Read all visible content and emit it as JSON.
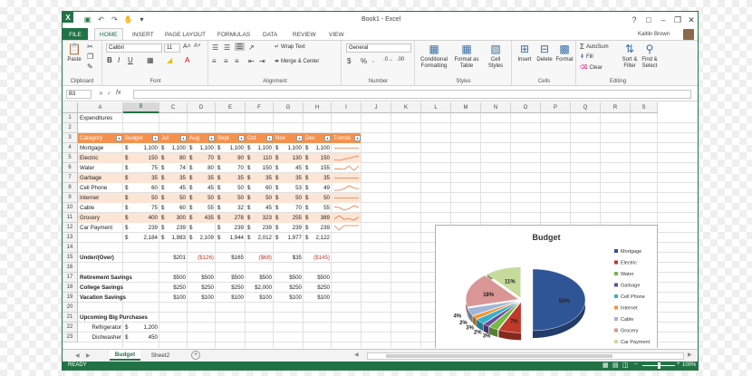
{
  "window": {
    "title": "Book1 - Excel",
    "help": "?",
    "user": "Kaitlin Brown"
  },
  "tabs": [
    "FILE",
    "HOME",
    "INSERT",
    "PAGE LAYOUT",
    "FORMULAS",
    "DATA",
    "REVIEW",
    "VIEW"
  ],
  "ribbon": {
    "clipboard": {
      "paste": "Paste",
      "label": "Clipboard"
    },
    "font": {
      "name": "Calibri",
      "size": "11",
      "label": "Font"
    },
    "alignment": {
      "wrap": "Wrap Text",
      "merge": "Merge & Center",
      "label": "Alignment"
    },
    "number": {
      "format": "General",
      "label": "Number"
    },
    "styles": {
      "conditional": "Conditional Formatting",
      "table": "Format as Table",
      "cell": "Cell Styles",
      "label": "Styles"
    },
    "cells": {
      "insert": "Insert",
      "delete": "Delete",
      "format": "Format",
      "label": "Cells"
    },
    "editing": {
      "autosum": "AutoSum",
      "fill": "Fill",
      "clear": "Clear",
      "sort": "Sort & Filter",
      "find": "Find & Select",
      "label": "Editing"
    }
  },
  "formula_bar": {
    "name_box": "B3",
    "fx": "fx",
    "value": ""
  },
  "columns": [
    "A",
    "B",
    "C",
    "D",
    "E",
    "F",
    "G",
    "H",
    "I",
    "J",
    "K",
    "L",
    "M",
    "N",
    "O",
    "P",
    "Q",
    "R",
    "S"
  ],
  "selected_column": "B",
  "rows": [
    "1",
    "2",
    "3",
    "4",
    "5",
    "6",
    "7",
    "8",
    "9",
    "10",
    "11",
    "12",
    "13",
    "14",
    "15",
    "16",
    "17",
    "18",
    "19",
    "20",
    "21",
    "22",
    "23"
  ],
  "sheet": {
    "r1": "Expenditures",
    "headers": [
      "Category",
      "Budget",
      "Jul",
      "Aug",
      "Sept",
      "Oct",
      "Nov",
      "Dec",
      "Trends"
    ],
    "items": [
      {
        "cat": "Mortgage",
        "v": [
          "1,100",
          "1,100",
          "1,100",
          "1,100",
          "1,100",
          "1,100",
          "1,100"
        ]
      },
      {
        "cat": "Electric",
        "v": [
          "150",
          "80",
          "70",
          "90",
          "110",
          "130",
          "150"
        ]
      },
      {
        "cat": "Water",
        "v": [
          "75",
          "74",
          "80",
          "70",
          "150",
          "45",
          "155"
        ]
      },
      {
        "cat": "Garbage",
        "v": [
          "35",
          "35",
          "35",
          "35",
          "35",
          "35",
          "35"
        ]
      },
      {
        "cat": "Cell Phone",
        "v": [
          "60",
          "45",
          "45",
          "50",
          "60",
          "53",
          "49"
        ]
      },
      {
        "cat": "Internet",
        "v": [
          "50",
          "50",
          "50",
          "50",
          "50",
          "50",
          "50"
        ]
      },
      {
        "cat": "Cable",
        "v": [
          "75",
          "60",
          "55",
          "32",
          "45",
          "70",
          "55"
        ]
      },
      {
        "cat": "Grocery",
        "v": [
          "400",
          "300",
          "435",
          "278",
          "323",
          "255",
          "389"
        ]
      },
      {
        "cat": "Car Payment",
        "v": [
          "239",
          "239",
          "",
          "239",
          "239",
          "239",
          "239"
        ]
      }
    ],
    "totals": [
      "2,184",
      "1,983",
      "2,109",
      "1,944",
      "2,012",
      "1,977",
      "2,122"
    ],
    "under_over": {
      "label": "Under/(Over)",
      "v": [
        "$201",
        "($126)",
        "$165",
        "($68)",
        "$35",
        "($145)"
      ]
    },
    "savings": [
      {
        "label": "Retirement Savings",
        "v": [
          "$500",
          "$500",
          "$500",
          "$500",
          "$500",
          "$500"
        ]
      },
      {
        "label": "College Savings",
        "v": [
          "$250",
          "$250",
          "$250",
          "$2,000",
          "$250",
          "$250"
        ]
      },
      {
        "label": "Vacation Savings",
        "v": [
          "$100",
          "$100",
          "$100",
          "$100",
          "$100",
          "$100"
        ]
      }
    ],
    "upcoming": {
      "label": "Upcoming Big Purchases",
      "items": [
        {
          "name": "Refrigerator",
          "value": "1,200"
        },
        {
          "name": "Dishwasher",
          "value": "450"
        }
      ]
    },
    "currency": "$"
  },
  "chart_data": {
    "type": "pie",
    "title": "Budget",
    "categories": [
      "Mortgage",
      "Electric",
      "Water",
      "Garbage",
      "Cell Phone",
      "Internet",
      "Cable",
      "Grocery",
      "Car Payment"
    ],
    "values": [
      50,
      7,
      3,
      2,
      3,
      2,
      4,
      18,
      11
    ],
    "labels": [
      "50%",
      "7%",
      "3%",
      "2%",
      "3%",
      "2%",
      "4%",
      "18%",
      "11%"
    ],
    "colors": [
      "#2f5597",
      "#c0392b",
      "#7ab648",
      "#6a4a9c",
      "#3ab0c9",
      "#f39533",
      "#9fb6d6",
      "#d99694",
      "#c6db9b"
    ],
    "legend": "right"
  },
  "sheet_tabs": [
    "Budget",
    "Sheet2"
  ],
  "active_sheet": "Budget",
  "status": {
    "ready": "READY",
    "zoom": "100%"
  }
}
